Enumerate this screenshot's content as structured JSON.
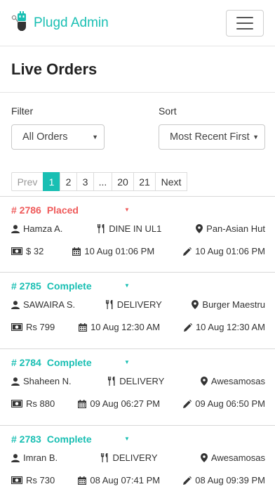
{
  "colors": {
    "accent": "#19bfb3",
    "placed": "#ef5a5a",
    "complete": "#19bfb3"
  },
  "navbar": {
    "brand": "Plugd Admin",
    "logo_icon": "robot-plug-icon",
    "menu_icon": "hamburger-icon"
  },
  "page": {
    "title": "Live Orders"
  },
  "filters": {
    "filter_label": "Filter",
    "filter_value": "All Orders",
    "sort_label": "Sort",
    "sort_value": "Most Recent First"
  },
  "pagination": {
    "prev": "Prev",
    "pages": [
      "1",
      "2",
      "3",
      "...",
      "20",
      "21"
    ],
    "active": "1",
    "next": "Next"
  },
  "orders": [
    {
      "id": "# 2786",
      "status": "Placed",
      "status_type": "placed",
      "customer": "Hamza A.",
      "mode": "DINE IN UL1",
      "restaurant": "Pan-Asian Hut",
      "amount": "$ 32",
      "placed_at": "10 Aug 01:06 PM",
      "updated_at": "10 Aug 01:06 PM"
    },
    {
      "id": "# 2785",
      "status": "Complete",
      "status_type": "complete",
      "customer": "SAWAIRA S.",
      "mode": "DELIVERY",
      "restaurant": "Burger Maestru",
      "amount": "Rs 799",
      "placed_at": "10 Aug 12:30 AM",
      "updated_at": "10 Aug 12:30 AM"
    },
    {
      "id": "# 2784",
      "status": "Complete",
      "status_type": "complete",
      "customer": "Shaheen N.",
      "mode": "DELIVERY",
      "restaurant": "Awesamosas",
      "amount": "Rs 880",
      "placed_at": "09 Aug 06:27 PM",
      "updated_at": "09 Aug 06:50 PM"
    },
    {
      "id": "# 2783",
      "status": "Complete",
      "status_type": "complete",
      "customer": "Imran B.",
      "mode": "DELIVERY",
      "restaurant": "Awesamosas",
      "amount": "Rs 730",
      "placed_at": "08 Aug 07:41 PM",
      "updated_at": "08 Aug 09:39 PM"
    }
  ]
}
